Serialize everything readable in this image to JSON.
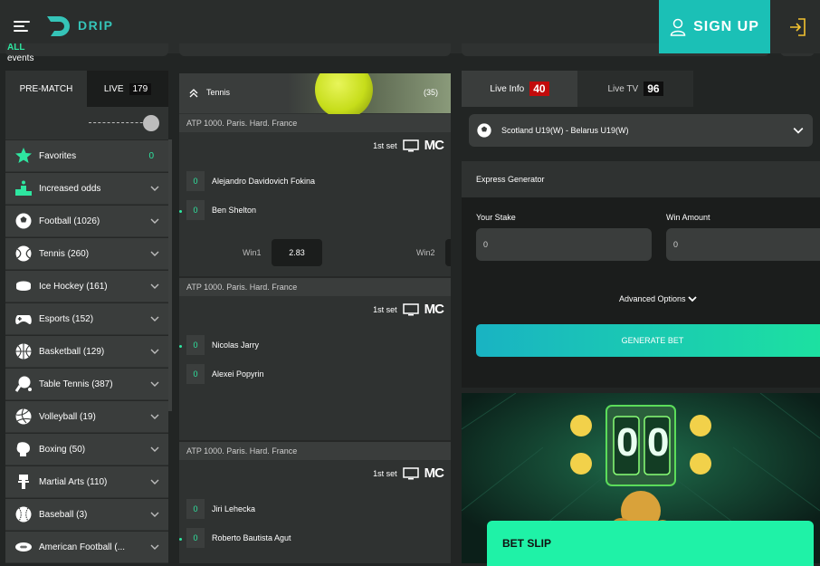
{
  "header": {
    "brand": "DRIP",
    "signup_label": "SIGN UP"
  },
  "sidebar": {
    "tabs": [
      {
        "label": "PRE-MATCH"
      },
      {
        "label": "LIVE",
        "count": "179"
      }
    ],
    "all_label": "ALL",
    "events_label": "events",
    "favorites": {
      "label": "Favorites",
      "count": "0"
    },
    "items": [
      {
        "label": "Increased odds",
        "icon": "podium-icon"
      },
      {
        "label": "Football (1026)",
        "icon": "football-icon"
      },
      {
        "label": "Tennis (260)",
        "icon": "tennis-ball-icon"
      },
      {
        "label": "Ice Hockey (161)",
        "icon": "hockey-puck-icon"
      },
      {
        "label": "Esports (152)",
        "icon": "gamepad-icon"
      },
      {
        "label": "Basketball (129)",
        "icon": "basketball-icon"
      },
      {
        "label": "Table Tennis (387)",
        "icon": "ping-pong-icon"
      },
      {
        "label": "Volleyball (19)",
        "icon": "volleyball-icon"
      },
      {
        "label": "Boxing (50)",
        "icon": "boxing-glove-icon"
      },
      {
        "label": "Martial Arts (110)",
        "icon": "martial-arts-icon"
      },
      {
        "label": "Baseball (3)",
        "icon": "baseball-icon"
      },
      {
        "label": "American Football (...",
        "icon": "american-football-icon"
      }
    ]
  },
  "events": {
    "sport": "Tennis",
    "count": "(35)",
    "matches": [
      {
        "league": "ATP 1000. Paris. Hard. France",
        "set": "1st set",
        "mc": "MC",
        "p1": {
          "name": "Alejandro Davidovich Fokina",
          "score": "0"
        },
        "p2": {
          "name": "Ben Shelton",
          "score": "0"
        },
        "win1_label": "Win1",
        "win1_odds": "2.83",
        "win2_label": "Win2"
      },
      {
        "league": "ATP 1000. Paris. Hard. France",
        "set": "1st set",
        "mc": "MC",
        "p1": {
          "name": "Nicolas Jarry",
          "score": "0"
        },
        "p2": {
          "name": "Alexei Popyrin",
          "score": "0"
        }
      },
      {
        "league": "ATP 1000. Paris. Hard. France",
        "set": "1st set",
        "mc": "MC",
        "p1": {
          "name": "Jiri Lehecka",
          "score": "0"
        },
        "p2": {
          "name": "Roberto Bautista Agut",
          "score": "0"
        }
      }
    ]
  },
  "right": {
    "tabs": [
      {
        "label": "Live Info",
        "count": "40"
      },
      {
        "label": "Live TV",
        "count": "96"
      }
    ],
    "selected_match": "Scotland U19(W) - Belarus U19(W)",
    "express": {
      "title": "Express Generator",
      "stake_label": "Your Stake",
      "stake_value": "0",
      "win_label": "Win Amount",
      "win_value": "0",
      "advanced_label": "Advanced Options",
      "generate_label": "GENERATE BET"
    },
    "promo": {
      "digits": [
        "0",
        "0"
      ]
    },
    "betslip_label": "BET SLIP"
  },
  "colors": {
    "accent": "#1bc0b6",
    "green": "#2ee6a0",
    "live_red": "#c20b0b",
    "betslip": "#1ff2a7"
  }
}
